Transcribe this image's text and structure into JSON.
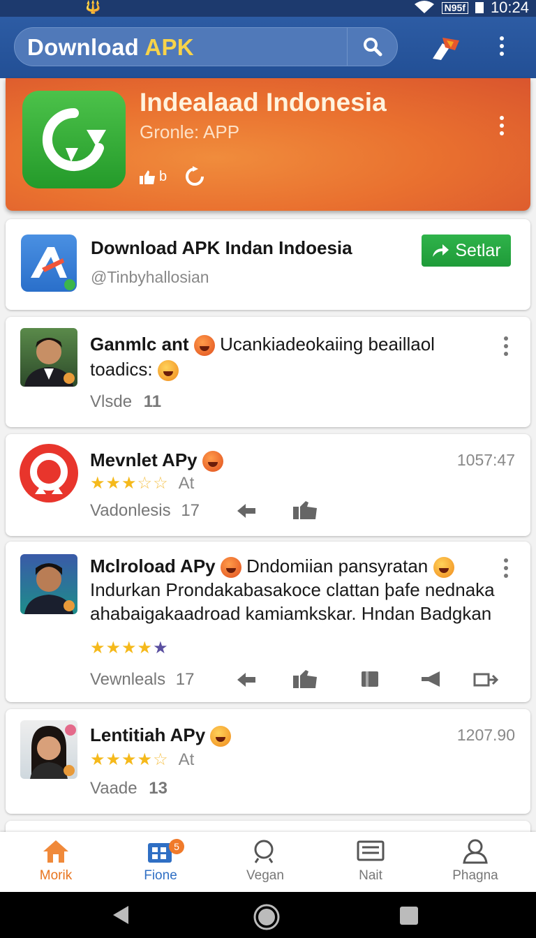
{
  "status_bar": {
    "network": "N95f",
    "time": "10:24"
  },
  "app_bar": {
    "title_main": "Download",
    "title_accent": "APK"
  },
  "hero": {
    "title": "Indealaad Indonesia",
    "subtitle": "Gronle: APP",
    "likes_label": "b"
  },
  "featured": {
    "title": "Download APK  Indan Indoesia",
    "handle": "@Tinbyhallosian",
    "button_label": "Setlar"
  },
  "posts": [
    {
      "name": "Ganmlc ant",
      "text": "Ucankiadeokaiing beaillaol",
      "text2": "toadics:",
      "views_label": "Vlsde",
      "views_count": "11"
    },
    {
      "name": "Mevnlet APy",
      "time": "1057:47",
      "rating": 3.5,
      "rating_label": "At",
      "stat_label": "Vadonlesis",
      "stat_count": "17"
    },
    {
      "name": "Mclroload APy",
      "text_inline": "Dndomiian pansyratan",
      "text": "Indurkan Prondakabasakoce clattan þafe nednaka ahabaigakaadroad kamiamkskar. Hndan Badgkan",
      "rating": 4.5,
      "stat_label": "Vewnleals",
      "stat_count": "17"
    },
    {
      "name": "Lentitiah APy",
      "time": "1207.90",
      "rating": 4,
      "rating_label": "At",
      "views_label": "Vaade",
      "views_count": "13"
    }
  ],
  "bottom_nav": [
    {
      "label": "Morik",
      "icon": "home-icon",
      "active": true
    },
    {
      "label": "Fione",
      "icon": "apps-icon",
      "badge": "5"
    },
    {
      "label": "Vegan",
      "icon": "search-icon"
    },
    {
      "label": "Nait",
      "icon": "list-icon"
    },
    {
      "label": "Phagna",
      "icon": "profile-icon"
    }
  ],
  "colors": {
    "app_bar": "#2d5ca4",
    "hero": "#e9702f",
    "accent_green": "#2fb34a",
    "star": "#f5b91b",
    "nav_active": "#e8741e"
  }
}
